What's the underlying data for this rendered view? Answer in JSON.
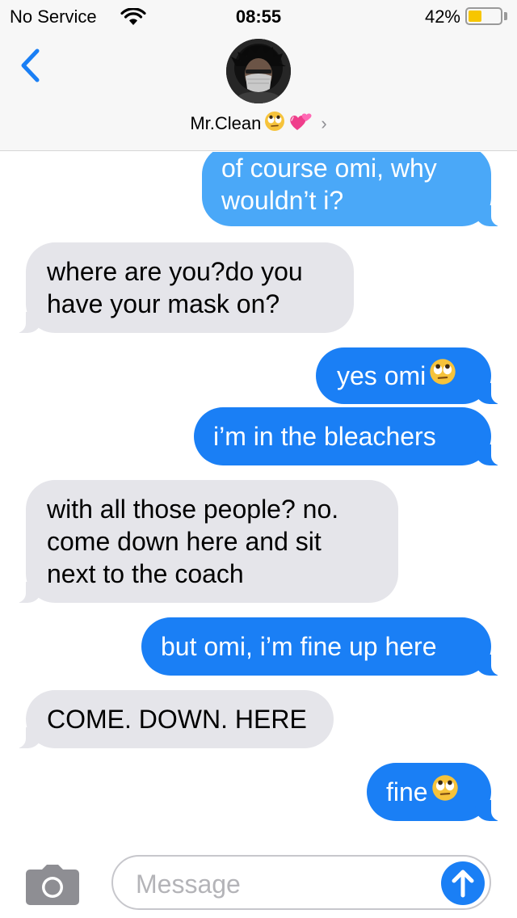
{
  "status_bar": {
    "carrier": "No Service",
    "time": "08:55",
    "battery_percent_label": "42%",
    "battery_level": 0.42,
    "battery_color": "#f7c600",
    "wifi_icon": "wifi-icon"
  },
  "header": {
    "back_icon": "chevron-left-icon",
    "contact_name": "Mr.Clean",
    "name_emojis": [
      "face-with-rolling-eyes-icon",
      "two-hearts-icon"
    ],
    "disclosure": "›",
    "avatar": "contact-avatar"
  },
  "colors": {
    "accent": "#1a7ff5",
    "bubble_incoming": "#e5e5ea",
    "bubble_outgoing_light": "#4aa8f8"
  },
  "messages": [
    {
      "direction": "out",
      "text": "of course omi, why",
      "text2": "wouldn’t i?"
    },
    {
      "direction": "in",
      "text": "where are you?do you",
      "text2": "have your mask on?"
    },
    {
      "direction": "out",
      "text": "yes omi",
      "emoji": "face-with-rolling-eyes-icon"
    },
    {
      "direction": "out",
      "text": "i’m in the bleachers"
    },
    {
      "direction": "in",
      "text": "with all those people? no.",
      "text2": "come down here and sit",
      "text3": "next to the coach"
    },
    {
      "direction": "out",
      "text": "but omi, i’m fine up here"
    },
    {
      "direction": "in",
      "text": "COME. DOWN. HERE"
    },
    {
      "direction": "out",
      "text": "fine",
      "emoji": "face-with-rolling-eyes-icon"
    }
  ],
  "input_bar": {
    "camera_icon": "camera-icon",
    "placeholder": "Message",
    "send_icon": "arrow-up-icon"
  }
}
